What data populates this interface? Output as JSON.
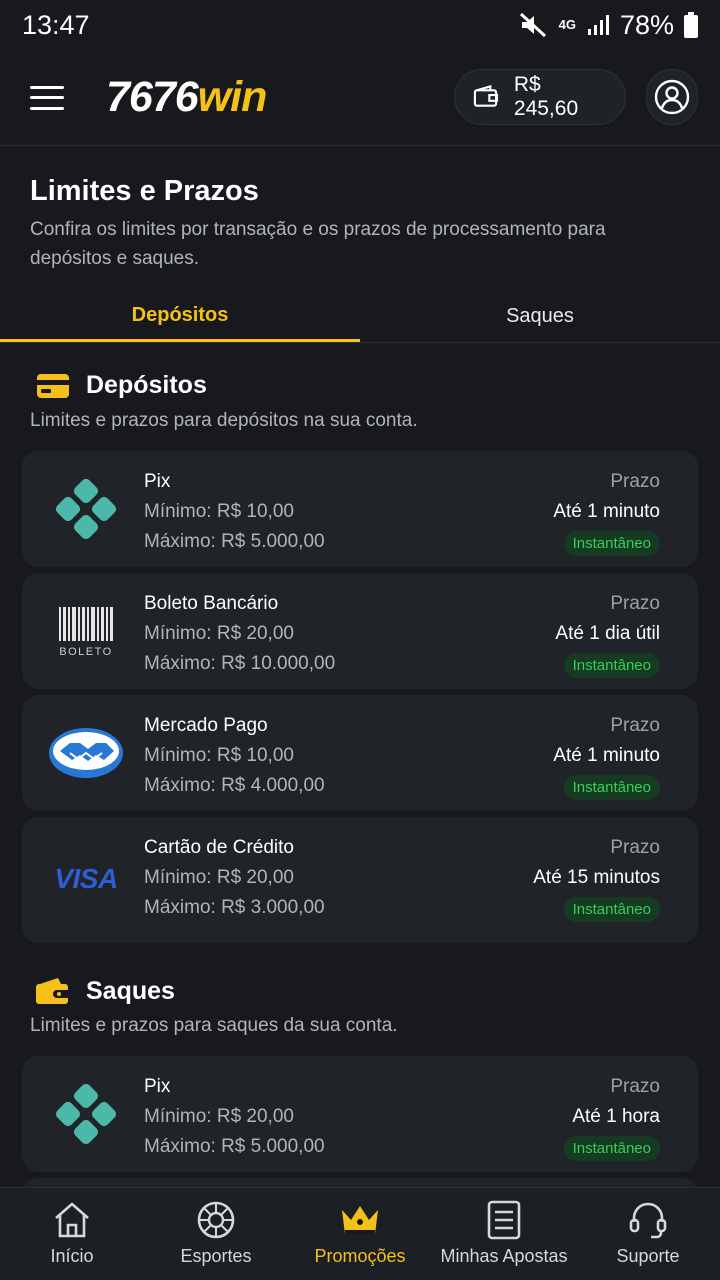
{
  "status_bar": {
    "time": "13:47",
    "network": "4G",
    "battery": "78%"
  },
  "header": {
    "logo_num": "7676",
    "logo_win": "win",
    "balance": "R$ 245,60"
  },
  "page": {
    "title": "Limites e Prazos",
    "subtitle": "Confira os limites por transação e os prazos de processamento para depósitos e saques."
  },
  "tabs": [
    {
      "label": "Depósitos",
      "active": true
    },
    {
      "label": "Saques",
      "active": false
    }
  ],
  "deposits": {
    "title": "Depósitos",
    "subtitle": "Limites e prazos para depósitos na sua conta.",
    "items": [
      {
        "name": "Pix",
        "min": "Mínimo: R$ 10,00",
        "max": "Máximo: R$ 5.000,00",
        "prazo_label": "Prazo",
        "prazo": "Até 1 minuto",
        "badge": "Instantâneo",
        "icon": "pix-icon"
      },
      {
        "name": "Boleto Bancário",
        "min": "Mínimo: R$ 20,00",
        "max": "Máximo: R$ 10.000,00",
        "prazo_label": "Prazo",
        "prazo": "Até 1 dia útil",
        "badge": "Instantâneo",
        "icon": "boleto-icon",
        "icon_text": "BOLETO"
      },
      {
        "name": "Mercado Pago",
        "min": "Mínimo: R$ 10,00",
        "max": "Máximo: R$ 4.000,00",
        "prazo_label": "Prazo",
        "prazo": "Até 1 minuto",
        "badge": "Instantâneo",
        "icon": "mercado-pago-icon"
      },
      {
        "name": "Cartão de Crédito",
        "min": "Mínimo: R$ 20,00",
        "max": "Máximo: R$ 3.000,00",
        "prazo_label": "Prazo",
        "prazo": "Até 15 minutos",
        "badge": "Instantâneo",
        "icon": "visa-icon",
        "icon_text": "VISA"
      }
    ]
  },
  "withdrawals": {
    "title": "Saques",
    "subtitle": "Limites e prazos para saques da sua conta.",
    "items": [
      {
        "name": "Pix",
        "min": "Mínimo: R$ 20,00",
        "max": "Máximo: R$ 5.000,00",
        "prazo_label": "Prazo",
        "prazo": "Até 1 hora",
        "badge": "Instantâneo",
        "icon": "pix-icon"
      }
    ]
  },
  "bottom_nav": [
    {
      "label": "Início",
      "icon": "home-icon",
      "active": false
    },
    {
      "label": "Esportes",
      "icon": "soccer-ball-icon",
      "active": false
    },
    {
      "label": "Promoções",
      "icon": "crown-icon",
      "active": true
    },
    {
      "label": "Minhas Apostas",
      "icon": "ticket-icon",
      "active": false
    },
    {
      "label": "Suporte",
      "icon": "headset-icon",
      "active": false
    }
  ],
  "colors": {
    "accent": "#f5c118",
    "background": "#17191d",
    "card": "#202327",
    "badge_text": "#34d058",
    "pix": "#4bb8a9"
  }
}
